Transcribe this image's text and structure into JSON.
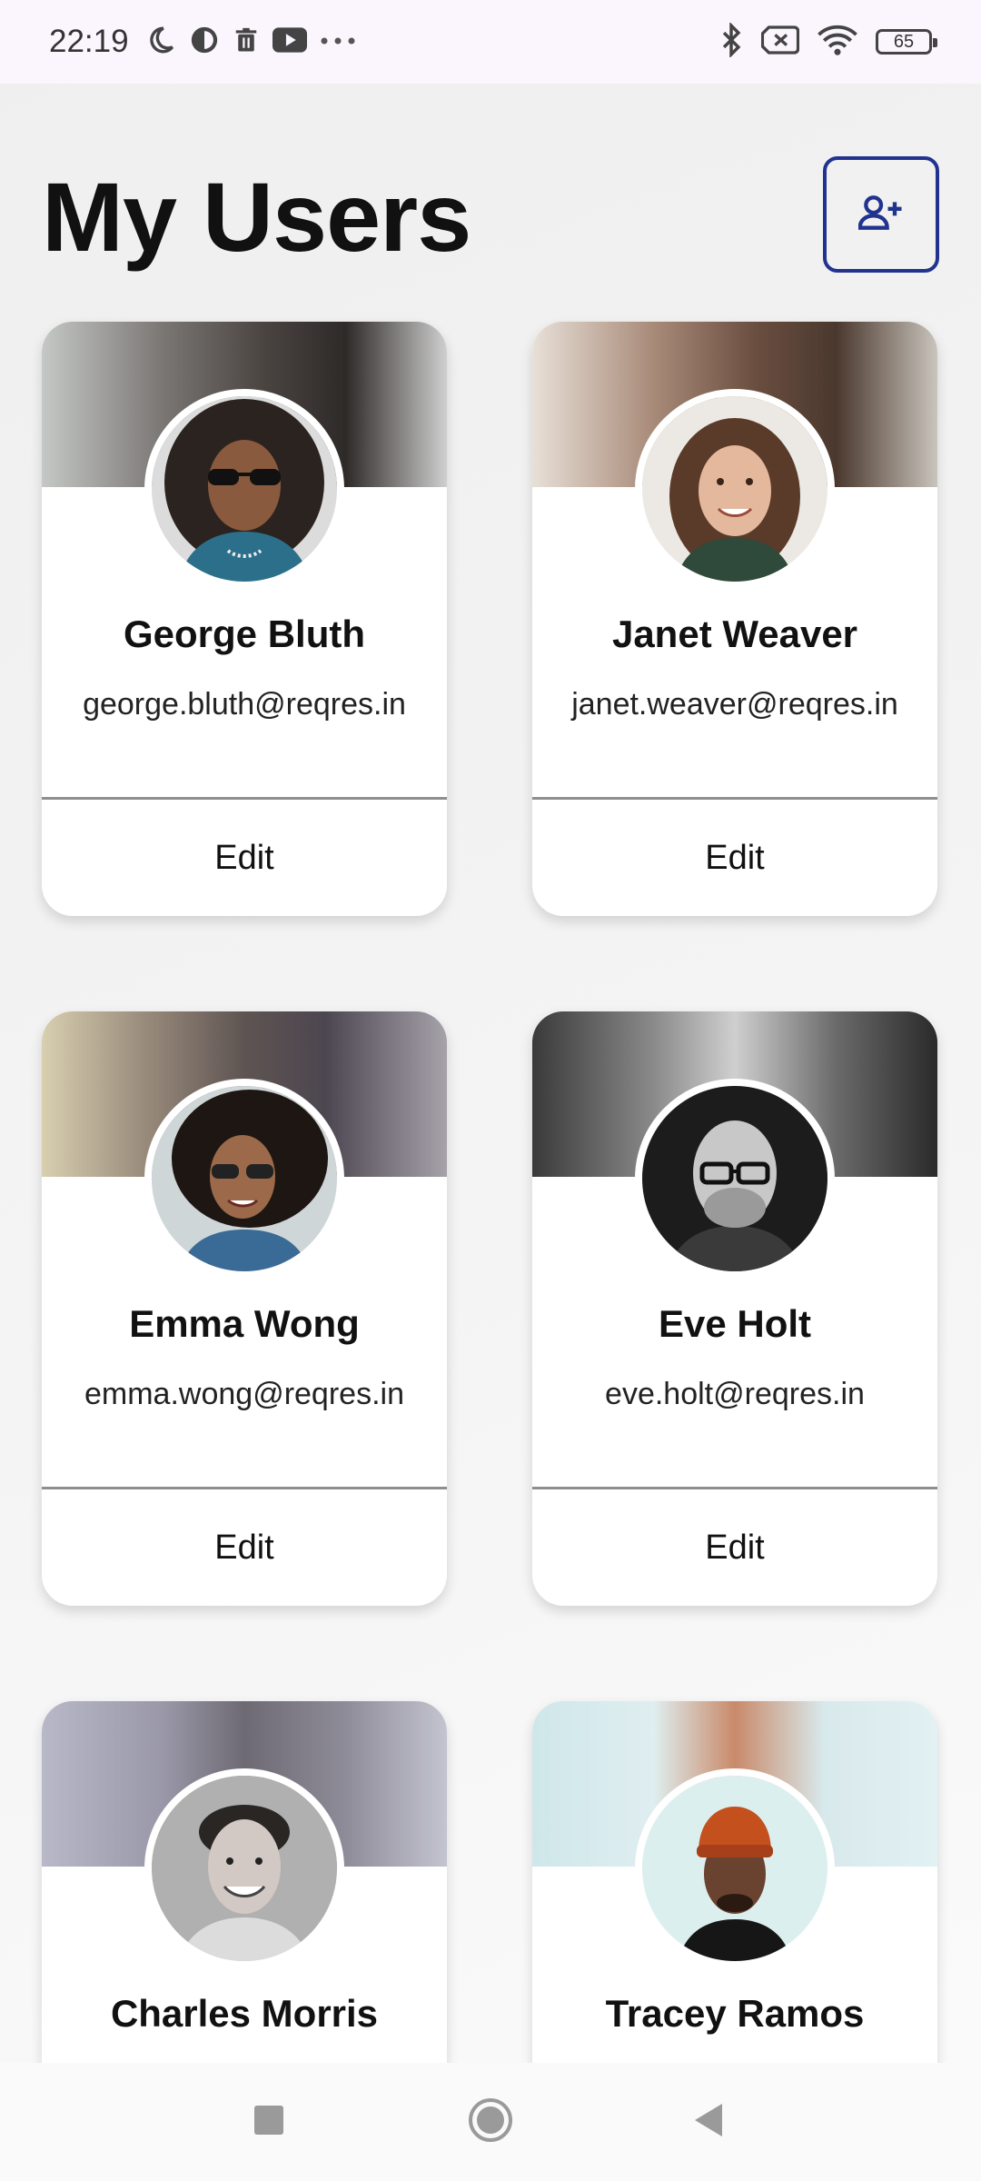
{
  "status_bar": {
    "time": "22:19",
    "left_icons": [
      "moon-icon",
      "data-saver-icon",
      "trash-icon",
      "youtube-icon",
      "more-dots-icon"
    ],
    "right_icons": [
      "bluetooth-icon",
      "no-sim-icon",
      "wifi-icon"
    ],
    "battery_level": "65"
  },
  "header": {
    "title": "My Users",
    "add_icon": "person-add-icon",
    "accent_color": "#22338f"
  },
  "users": [
    {
      "name": "George Bluth",
      "email": "george.bluth@reqres.in",
      "edit_label": "Edit"
    },
    {
      "name": "Janet Weaver",
      "email": "janet.weaver@reqres.in",
      "edit_label": "Edit"
    },
    {
      "name": "Emma Wong",
      "email": "emma.wong@reqres.in",
      "edit_label": "Edit"
    },
    {
      "name": "Eve Holt",
      "email": "eve.holt@reqres.in",
      "edit_label": "Edit"
    },
    {
      "name": "Charles Morris"
    },
    {
      "name": "Tracey Ramos"
    }
  ],
  "nav_bar": {
    "icons": [
      "recents-square-icon",
      "home-circle-icon",
      "back-triangle-icon"
    ]
  }
}
